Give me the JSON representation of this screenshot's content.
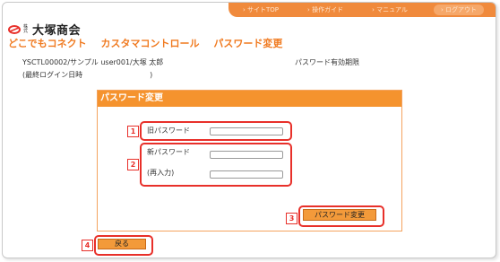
{
  "topnav": {
    "items": [
      "› サイトTOP",
      "› 操作ガイド",
      "› マニュアル",
      "› ログアウト"
    ]
  },
  "logo": {
    "kabushiki": "株式",
    "company": "大塚商会"
  },
  "header": {
    "product": "どこでもコネクト",
    "module": "カスタマコントロール",
    "page": "パスワード変更"
  },
  "user": {
    "info": "YSCTL00002/サンプル user001/大塚 太郎",
    "last_login_label": "(最終ログイン日時",
    "last_login_close": ")",
    "expiry_label": "パスワード有効期限"
  },
  "panel": {
    "title": "パスワード変更",
    "old_password_label": "旧パスワード",
    "new_password_label": "新パスワード",
    "confirm_label": "(再入力)",
    "submit_label": "パスワード変更"
  },
  "back_label": "戻る",
  "markers": [
    "1",
    "2",
    "3",
    "4"
  ],
  "colors": {
    "accent": "#f5932e",
    "highlight": "#e8302a",
    "title": "#f07a20"
  }
}
